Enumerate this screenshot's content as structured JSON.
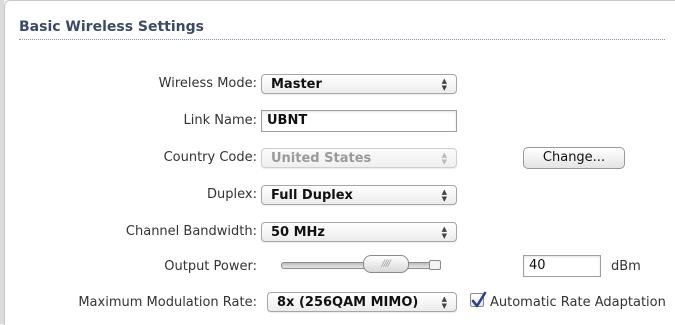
{
  "section": {
    "title": "Basic Wireless Settings"
  },
  "fields": {
    "wireless_mode": {
      "label": "Wireless Mode:",
      "value": "Master"
    },
    "link_name": {
      "label": "Link Name:",
      "value": "UBNT"
    },
    "country_code": {
      "label": "Country Code:",
      "value": "United States",
      "change_button": "Change..."
    },
    "duplex": {
      "label": "Duplex:",
      "value": "Full Duplex"
    },
    "channel_bandwidth": {
      "label": "Channel Bandwidth:",
      "value": "50 MHz"
    },
    "output_power": {
      "label": "Output Power:",
      "value": "40",
      "unit": "dBm",
      "slider_fraction": 0.73
    },
    "max_modulation_rate": {
      "label": "Maximum Modulation Rate:",
      "value": "8x (256QAM MIMO)"
    },
    "auto_rate_adaptation": {
      "label": "Automatic Rate Adaptation",
      "checked": true
    }
  },
  "icons": {
    "select_arrows": "updown-arrows-icon",
    "checkmark": "checkmark-icon",
    "slider_grip": "slider-grip-icon"
  },
  "colors": {
    "title": "#3b4a66",
    "checkmark": "#2b3f8f"
  }
}
